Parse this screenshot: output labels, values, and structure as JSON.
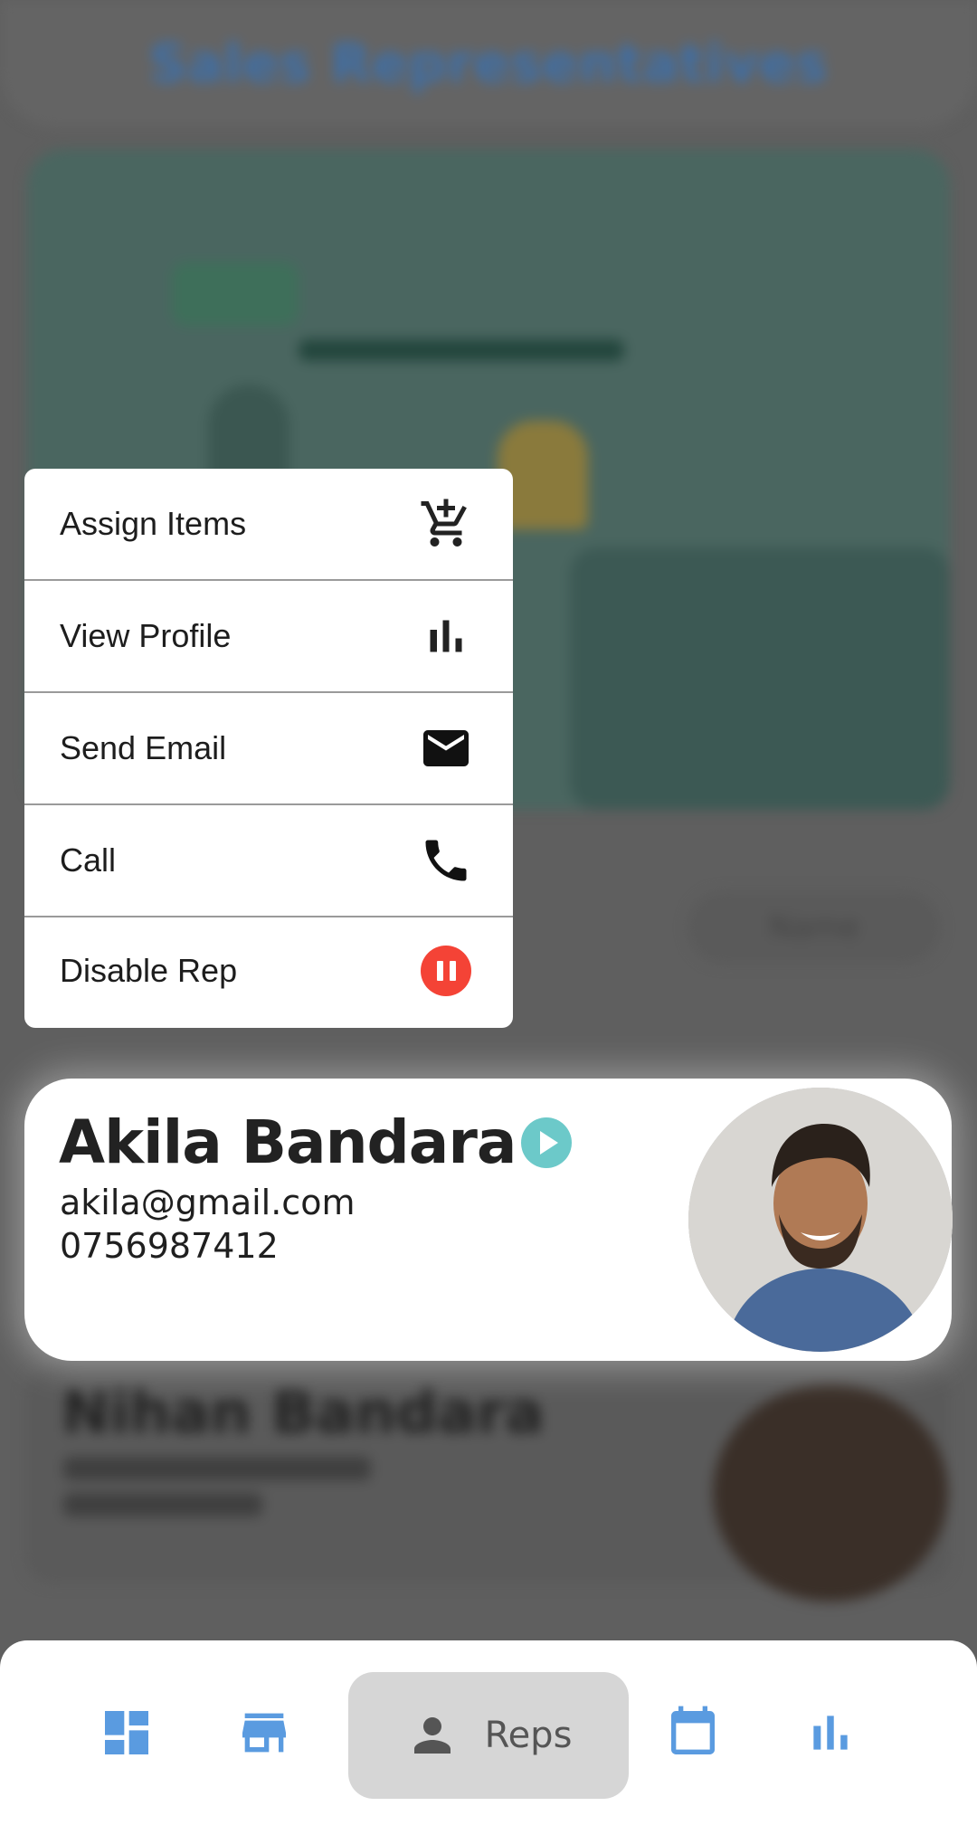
{
  "background": {
    "page_title": "Sales Representatives",
    "filter_label": "Name",
    "next_rep_name": "Nihan Bandara"
  },
  "menu": {
    "items": [
      {
        "label": "Assign Items",
        "icon": "add-shopping-cart-icon"
      },
      {
        "label": "View Profile",
        "icon": "bar-chart-icon"
      },
      {
        "label": "Send Email",
        "icon": "mail-icon"
      },
      {
        "label": "Call",
        "icon": "phone-icon"
      },
      {
        "label": "Disable Rep",
        "icon": "pause-circle-icon",
        "icon_color": "#f44336"
      }
    ]
  },
  "rep": {
    "name": "Akila Bandara",
    "email": "akila@gmail.com",
    "phone": "0756987412",
    "status_icon": "play-circle-icon",
    "status_color": "#6cc9c9"
  },
  "nav": {
    "items": [
      {
        "icon": "dashboard-icon"
      },
      {
        "icon": "store-icon"
      },
      {
        "icon": "person-icon",
        "label": "Reps",
        "active": true
      },
      {
        "icon": "calendar-icon"
      },
      {
        "icon": "bar-chart-icon"
      }
    ],
    "accent_color": "#5a9be0"
  }
}
